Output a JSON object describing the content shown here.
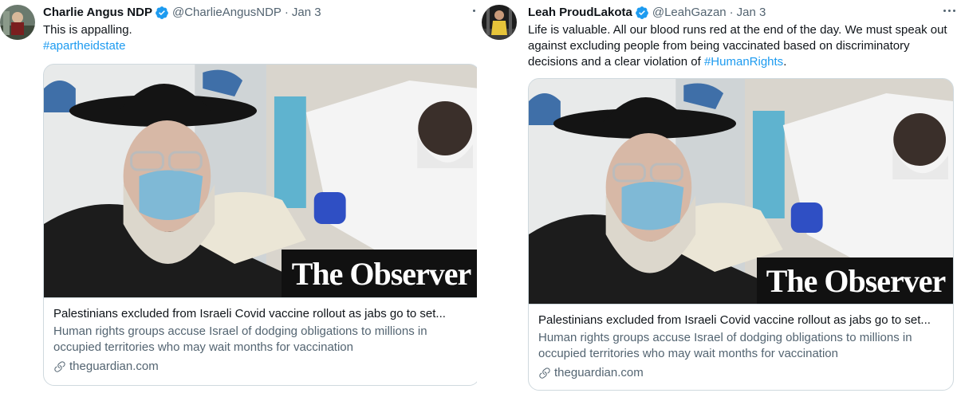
{
  "tweets": [
    {
      "author_name": "Charlie Angus NDP",
      "handle": "@CharlieAngusNDP",
      "separator": "·",
      "date": "Jan 3",
      "text_lines": [
        "This is appalling."
      ],
      "hashtag": "#apartheidstate",
      "card": {
        "logo_text": "The Observer",
        "title": "Palestinians excluded from Israeli Covid vaccine rollout as jabs go to set...",
        "description": "Human rights groups accuse Israel of dodging obligations to millions in occupied territories who may wait months for vaccination",
        "domain": "theguardian.com"
      }
    },
    {
      "author_name": "Leah ProudLakota",
      "handle": "@LeahGazan",
      "separator": "·",
      "date": "Jan 3",
      "text_main": "Life is valuable.  All our blood runs red at the end of the day.  We must speak out against excluding people from being vaccinated based on discriminatory decisions and a clear violation of ",
      "hashtag": "#HumanRights",
      "text_end": ".",
      "card": {
        "logo_text": "The Observer",
        "title": "Palestinians excluded from Israeli Covid vaccine rollout as jabs go to set...",
        "description": "Human rights groups accuse Israel of dodging obligations to millions in occupied territories who may wait months for vaccination",
        "domain": "theguardian.com"
      }
    }
  ],
  "icons": {
    "verified": "verified-badge-icon",
    "more": "more-options-icon",
    "link": "link-icon"
  },
  "colors": {
    "link": "#1d9bf0",
    "verified": "#1d9bf0",
    "secondary_text": "#536471",
    "card_border": "#cfd9de"
  }
}
